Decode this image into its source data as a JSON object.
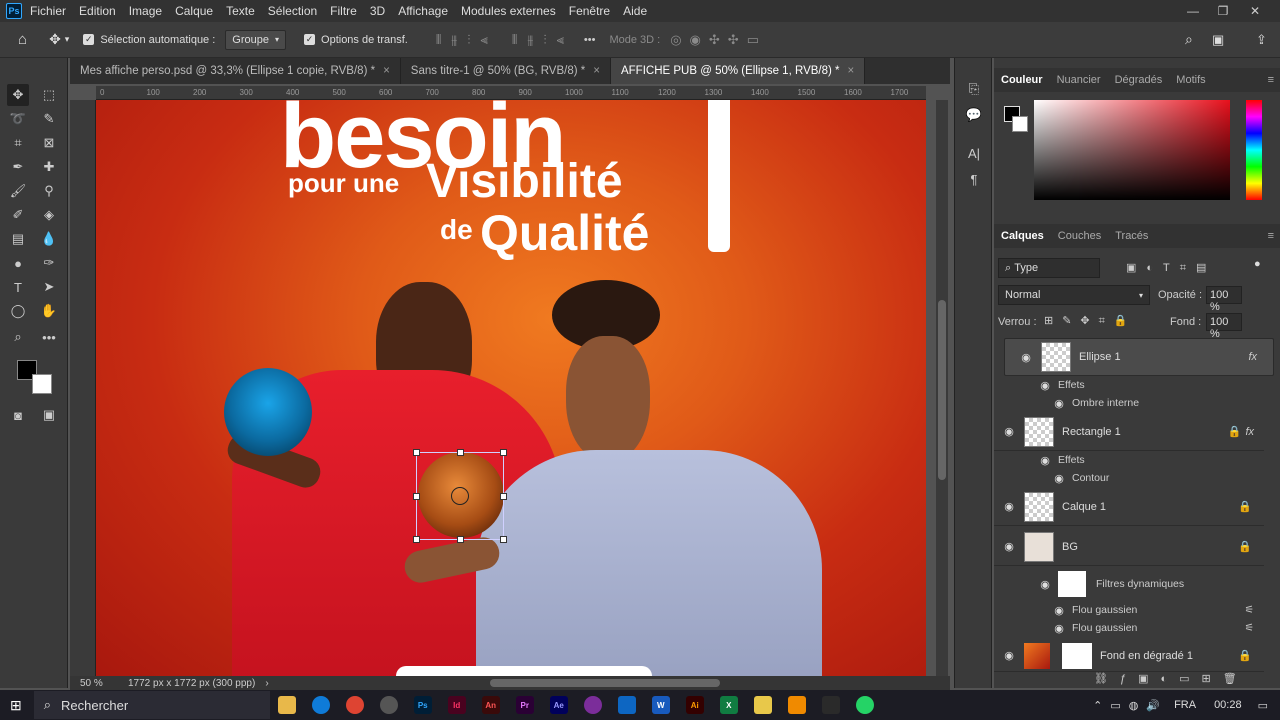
{
  "menu": {
    "items": [
      "Fichier",
      "Edition",
      "Image",
      "Calque",
      "Texte",
      "Sélection",
      "Filtre",
      "3D",
      "Affichage",
      "Modules externes",
      "Fenêtre",
      "Aide"
    ],
    "logo": "Ps"
  },
  "options": {
    "auto_select_label": "Sélection automatique :",
    "auto_select_value": "Groupe",
    "transform_label": "Options de transf.",
    "mode3d_label": "Mode 3D :",
    "more": "•••"
  },
  "tabs": [
    {
      "label": "Mes affiche perso.psd @ 33,3% (Ellipse 1 copie, RVB/8) *",
      "close": "×"
    },
    {
      "label": "Sans titre-1 @ 50% (BG, RVB/8) *",
      "close": "×"
    },
    {
      "label": "AFFICHE PUB @ 50% (Ellipse 1, RVB/8) *",
      "close": "×"
    }
  ],
  "ruler": {
    "ticks": [
      "0",
      "100",
      "200",
      "300",
      "400",
      "500",
      "600",
      "700",
      "800",
      "900",
      "1000",
      "1100",
      "1200",
      "1300",
      "1400",
      "1500",
      "1600",
      "1700"
    ]
  },
  "canvas": {
    "line1": "besoin",
    "line2a": "pour une",
    "line2b": "Visibilité",
    "line3a": "de",
    "line3b": "Qualité"
  },
  "status": {
    "zoom": "50 %",
    "doc_size": "1772 px x 1772 px (300 ppp)"
  },
  "color_panel": {
    "tabs": [
      "Couleur",
      "Nuancier",
      "Dégradés",
      "Motifs"
    ]
  },
  "layers_panel": {
    "tabs": [
      "Calques",
      "Couches",
      "Tracés"
    ],
    "filter_value": "Type",
    "blend_mode": "Normal",
    "opacity_label": "Opacité :",
    "opacity_value": "100 %",
    "lock_label": "Verrou :",
    "fill_label": "Fond :",
    "fill_value": "100 %",
    "layers": [
      {
        "name": "Ellipse 1",
        "fx": "fx",
        "effects_label": "Effets",
        "effect": "Ombre interne"
      },
      {
        "name": "Rectangle 1",
        "fx": "fx",
        "effects_label": "Effets",
        "effect": "Contour"
      },
      {
        "name": "Calque 1"
      },
      {
        "name": "BG",
        "filters_label": "Filtres dynamiques",
        "filter1": "Flou gaussien",
        "filter2": "Flou gaussien"
      },
      {
        "name": "Fond en dégradé 1"
      }
    ]
  },
  "taskbar": {
    "search_placeholder": "Rechercher",
    "lang": "FRA",
    "time": "00:28",
    "apps": [
      "Ps",
      "Id",
      "An",
      "Pr",
      "Ae",
      "W",
      "Ai",
      "X"
    ]
  },
  "colors": {
    "accent": "#31a8ff",
    "fg_swatch": "#000000",
    "bg_swatch": "#ffffff"
  }
}
